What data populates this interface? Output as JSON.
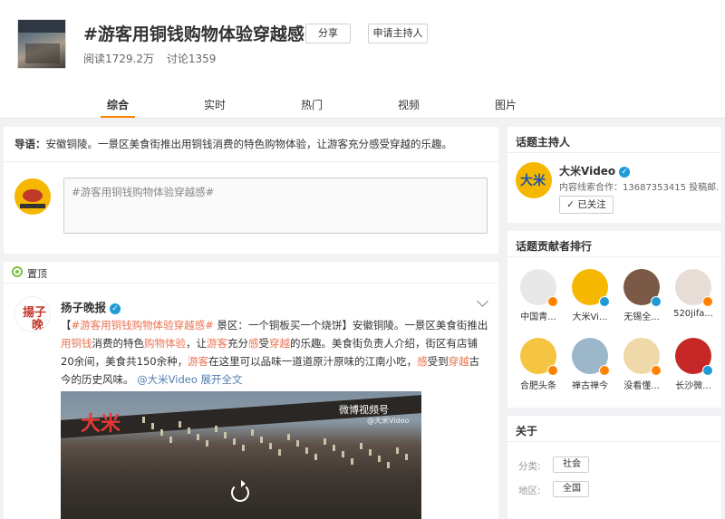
{
  "header": {
    "topic_title": "#游客用铜钱购物体验穿越感#",
    "share_label": "分享",
    "apply_host_label": "申请主持人",
    "reads": "阅读1729.2万",
    "discussions": "讨论1359"
  },
  "tabs": [
    {
      "label": "综合",
      "active": true
    },
    {
      "label": "实时",
      "active": false
    },
    {
      "label": "热门",
      "active": false
    },
    {
      "label": "视频",
      "active": false
    },
    {
      "label": "图片",
      "active": false
    }
  ],
  "guide": {
    "label": "导语：",
    "text": "安徽铜陵。一景区美食街推出用铜钱消费的特色购物体验，让游客充分感受穿越的乐趣。"
  },
  "compose": {
    "placeholder": "#游客用铜钱购物体验穿越感#"
  },
  "pinned_label": "置顶",
  "post": {
    "author": "扬子晚报",
    "avatar_text_1": "揚子",
    "avatar_text_2": "晚報",
    "segments": [
      {
        "t": "【",
        "c": ""
      },
      {
        "t": "#游客用铜钱购物体验穿越感#",
        "c": "hl"
      },
      {
        "t": " 景区：一个铜板买一个烧饼】安徽铜陵。一景区美食街推出",
        "c": ""
      },
      {
        "t": "用铜钱",
        "c": "hl"
      },
      {
        "t": "消费的特色",
        "c": ""
      },
      {
        "t": "购物体验",
        "c": "hl"
      },
      {
        "t": "，让",
        "c": ""
      },
      {
        "t": "游客",
        "c": "hl"
      },
      {
        "t": "充分",
        "c": ""
      },
      {
        "t": "感",
        "c": "hl"
      },
      {
        "t": "受",
        "c": ""
      },
      {
        "t": "穿越",
        "c": "hl"
      },
      {
        "t": "的乐趣。美食街负责人介绍，街区有店铺20余间，美食共150余种，",
        "c": ""
      },
      {
        "t": "游客",
        "c": "hl"
      },
      {
        "t": "在这里可以品味一道道原汁原味的江南小吃，",
        "c": ""
      },
      {
        "t": "感",
        "c": "hl"
      },
      {
        "t": "受到",
        "c": ""
      },
      {
        "t": "穿越",
        "c": "hl"
      },
      {
        "t": "古今的历史风味。 ",
        "c": ""
      },
      {
        "t": "@大米Video",
        "c": "lk"
      },
      {
        "t": " 展开全文",
        "c": "lk"
      }
    ],
    "video_logo": "大米",
    "watermark": "微博视频号",
    "watermark_sub": "@大米Video"
  },
  "host": {
    "title": "话题主持人",
    "avatar_text": "大米",
    "name": "大米Video",
    "desc": "内容线索合作：13687353415 投稿邮...",
    "follow_label": "已关注"
  },
  "ranking": {
    "title": "话题贡献者排行",
    "items": [
      {
        "name": "中国青...",
        "color": "#e8e8e8",
        "badge": "orange"
      },
      {
        "name": "大米Vi...",
        "color": "#f6b700",
        "badge": "blue"
      },
      {
        "name": "无锡全...",
        "color": "#7a5a46",
        "badge": "blue"
      },
      {
        "name": "520jifa...",
        "color": "#e7dcd6",
        "badge": "orange"
      },
      {
        "name": "合肥头条",
        "color": "#f5c542",
        "badge": "orange"
      },
      {
        "name": "禅古禅今",
        "color": "#9bb7c9",
        "badge": "orange"
      },
      {
        "name": "没看懂...",
        "color": "#f0d9a8",
        "badge": "orange"
      },
      {
        "name": "长沙微...",
        "color": "#c62828",
        "badge": "blue"
      }
    ]
  },
  "about": {
    "title": "关于",
    "category_label": "分类:",
    "category_value": "社会",
    "region_label": "地区:",
    "region_value": "全国"
  },
  "colors": {
    "accent": "#ff8200",
    "highlight": "#eb7350",
    "link": "#507daf",
    "verified": "#1e9bd7"
  }
}
